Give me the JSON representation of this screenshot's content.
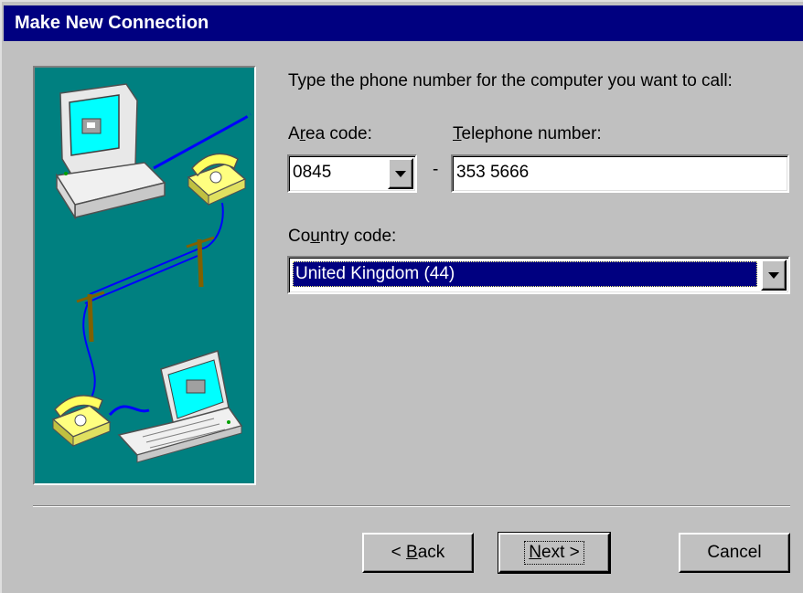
{
  "window": {
    "title": "Make New Connection"
  },
  "instruction": "Type the phone number for the computer you want to call:",
  "area_code": {
    "label_pre": "A",
    "label_key": "r",
    "label_post": "ea code:",
    "value": "0845"
  },
  "dash": "-",
  "telephone": {
    "label_key": "T",
    "label_post": "elephone number:",
    "value": "353 5666"
  },
  "country": {
    "label_pre": "Co",
    "label_key": "u",
    "label_post": "ntry code:",
    "value": "United Kingdom (44)"
  },
  "buttons": {
    "back": {
      "pre": "< ",
      "key": "B",
      "post": "ack"
    },
    "next": {
      "key": "N",
      "post": "ext >"
    },
    "cancel": {
      "label": "Cancel"
    }
  },
  "colors": {
    "titlebar": "#000080",
    "face": "#c0c0c0",
    "picture_bg": "#008080",
    "selection": "#000080"
  },
  "icons": [
    "desktop-computer-icon",
    "telephone-icon",
    "telephone-pole-icon",
    "laptop-icon"
  ]
}
